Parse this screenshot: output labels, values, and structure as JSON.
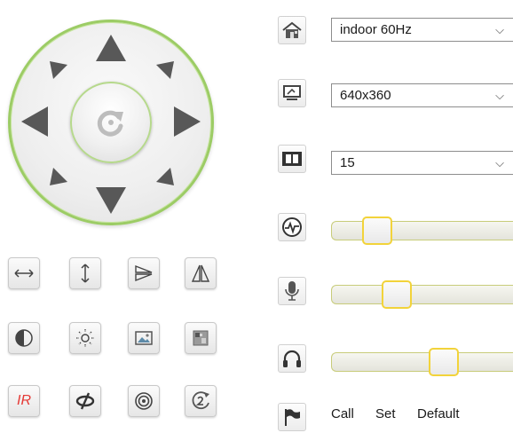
{
  "settings": {
    "light_mode": {
      "icon": "home-icon",
      "value": "indoor 60Hz"
    },
    "resolution": {
      "icon": "monitor-icon",
      "value": "640x360"
    },
    "frame_rate": {
      "icon": "film-icon",
      "value": "15"
    },
    "dropdown_chevron": "⌵"
  },
  "sliders": [
    {
      "name": "video-quality",
      "icon": "pulse-icon",
      "level": 0.2
    },
    {
      "name": "microphone-volume",
      "icon": "microphone-icon",
      "level": 0.33
    },
    {
      "name": "speaker-volume",
      "icon": "headphones-icon",
      "level": 0.64
    }
  ],
  "call_preset": {
    "icon": "flag-icon",
    "call_label": "Call",
    "set_label": "Set",
    "default_label": "Default"
  },
  "tool_buttons": {
    "ir_label": "IR"
  },
  "colors": {
    "ring_green": "#9ccc65",
    "arrow_gray": "#585858",
    "thumb_yellow": "#f2d33a",
    "ir_red": "#e53935",
    "icon_green": "#4caf50"
  }
}
